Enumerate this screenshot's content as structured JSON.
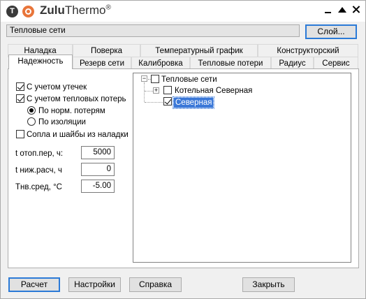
{
  "window": {
    "app_name_bold": "Zulu",
    "app_name_rest": "Thermo",
    "trademark": "®",
    "logo_letter": "T"
  },
  "layer": {
    "value": "Тепловые сети",
    "button_label": "Слой..."
  },
  "tabs_row1": [
    "Наладка",
    "Поверка",
    "Температурный график",
    "Конструкторский"
  ],
  "tabs_row2": [
    "Надежность",
    "Резерв сети",
    "Калибровка",
    "Тепловые потери",
    "Радиус",
    "Сервис"
  ],
  "active_tab": "Надежность",
  "options": {
    "leaks": {
      "label": "С учетом утечек",
      "checked": true
    },
    "heat_losses": {
      "label": "С учетом тепловых потерь",
      "checked": true
    },
    "radio_norm": {
      "label": "По норм. потерям",
      "selected": true
    },
    "radio_insulation": {
      "label": "По изоляции",
      "selected": false
    },
    "nozzles": {
      "label": "Сопла и шайбы из наладки",
      "checked": false
    }
  },
  "fields": {
    "t_heating": {
      "label": "t отоп.пер, ч:",
      "value": "5000"
    },
    "t_lower": {
      "label": "t ниж.расч, ч",
      "value": "0"
    },
    "t_avg": {
      "label": "Тнв.сред, °С",
      "value": "-5.00"
    }
  },
  "tree": {
    "root": {
      "label": "Тепловые сети",
      "checked": false,
      "expand_symbol": "−"
    },
    "child1": {
      "label": "Котельная Северная",
      "checked": false,
      "expand_symbol": "+"
    },
    "child2": {
      "label": "Северная",
      "checked": true,
      "selected": true
    }
  },
  "footer": {
    "calc": "Расчет",
    "settings": "Настройки",
    "help": "Справка",
    "close": "Закрыть"
  },
  "colors": {
    "accent": "#2b7ad7",
    "selection": "#3b78d8",
    "logo_orange": "#e8753a"
  }
}
